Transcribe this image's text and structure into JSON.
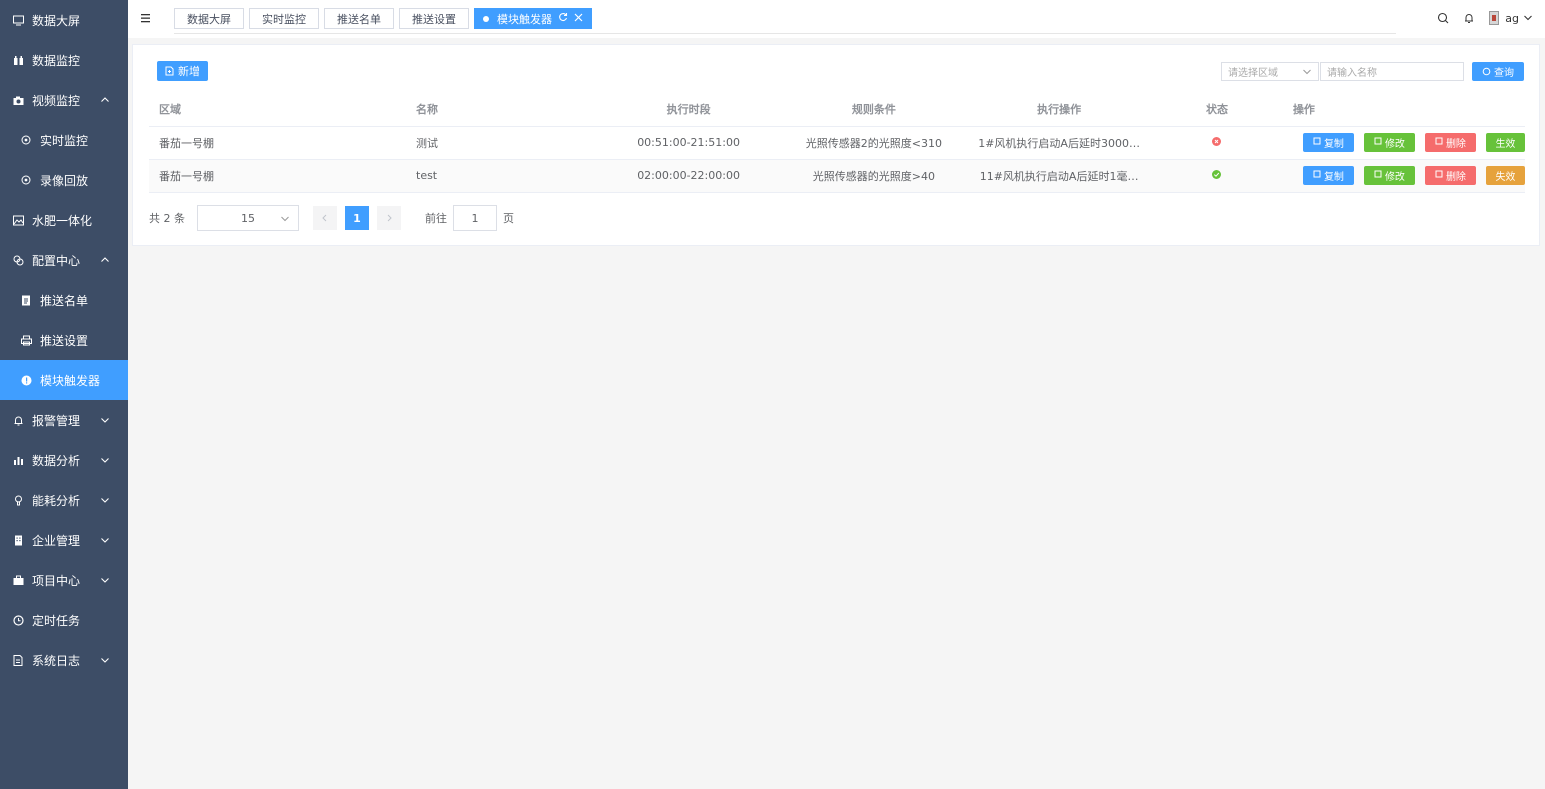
{
  "sidebar": {
    "items": [
      {
        "label": "数据大屏",
        "icon": "monitor-icon",
        "sub": false,
        "active": false,
        "arrow": ""
      },
      {
        "label": "数据监控",
        "icon": "binoculars-icon",
        "sub": false,
        "active": false,
        "arrow": ""
      },
      {
        "label": "视频监控",
        "icon": "camera-icon",
        "sub": false,
        "active": false,
        "arrow": "up"
      },
      {
        "label": "实时监控",
        "icon": "record-icon",
        "sub": true,
        "active": false,
        "arrow": ""
      },
      {
        "label": "录像回放",
        "icon": "record-icon",
        "sub": true,
        "active": false,
        "arrow": ""
      },
      {
        "label": "水肥一体化",
        "icon": "image-icon",
        "sub": false,
        "active": false,
        "arrow": ""
      },
      {
        "label": "配置中心",
        "icon": "config-icon",
        "sub": false,
        "active": false,
        "arrow": "up"
      },
      {
        "label": "推送名单",
        "icon": "document-icon",
        "sub": true,
        "active": false,
        "arrow": ""
      },
      {
        "label": "推送设置",
        "icon": "printer-icon",
        "sub": true,
        "active": false,
        "arrow": ""
      },
      {
        "label": "模块触发器",
        "icon": "info-icon",
        "sub": true,
        "active": true,
        "arrow": ""
      },
      {
        "label": "报警管理",
        "icon": "bell-icon",
        "sub": false,
        "active": false,
        "arrow": "down"
      },
      {
        "label": "数据分析",
        "icon": "bar-chart-icon",
        "sub": false,
        "active": false,
        "arrow": "down"
      },
      {
        "label": "能耗分析",
        "icon": "bulb-icon",
        "sub": false,
        "active": false,
        "arrow": "down"
      },
      {
        "label": "企业管理",
        "icon": "building-icon",
        "sub": false,
        "active": false,
        "arrow": "down"
      },
      {
        "label": "项目中心",
        "icon": "briefcase-icon",
        "sub": false,
        "active": false,
        "arrow": "down"
      },
      {
        "label": "定时任务",
        "icon": "clock-icon",
        "sub": false,
        "active": false,
        "arrow": ""
      },
      {
        "label": "系统日志",
        "icon": "log-icon",
        "sub": false,
        "active": false,
        "arrow": "down"
      }
    ]
  },
  "header": {
    "tabs": [
      {
        "label": "数据大屏",
        "active": false
      },
      {
        "label": "实时监控",
        "active": false
      },
      {
        "label": "推送名单",
        "active": false
      },
      {
        "label": "推送设置",
        "active": false
      },
      {
        "label": "模块触发器",
        "active": true
      }
    ],
    "user": "ag"
  },
  "toolbar": {
    "add_label": "新增",
    "area_placeholder": "请选择区域",
    "name_placeholder": "请输入名称",
    "query_label": "查询"
  },
  "table": {
    "headers": [
      "区域",
      "名称",
      "执行时段",
      "规则条件",
      "执行操作",
      "状态",
      "操作"
    ],
    "rows": [
      {
        "area": "番茄一号棚",
        "name": "测试",
        "period": "00:51:00-21:51:00",
        "rule": "光照传感器2的光照度<310",
        "action": "1#风机执行启动A后延时3000…",
        "status": "off",
        "toggle": "生效"
      },
      {
        "area": "番茄一号棚",
        "name": "test",
        "period": "02:00:00-22:00:00",
        "rule": "光照传感器的光照度>40",
        "action": "11#风机执行启动A后延时1毫…",
        "status": "on",
        "toggle": "失效"
      }
    ],
    "op_labels": {
      "copy": "复制",
      "edit": "修改",
      "delete": "删除"
    }
  },
  "pager": {
    "total": "共 2 条",
    "page_size": "15",
    "current": "1",
    "goto_label": "前往",
    "goto_value": "1",
    "page_unit": "页"
  },
  "colors": {
    "sidebar_bg": "#3d4d66",
    "accent": "#409eff",
    "success": "#67c23a",
    "danger": "#f56c6c",
    "warning": "#e6a23c"
  }
}
